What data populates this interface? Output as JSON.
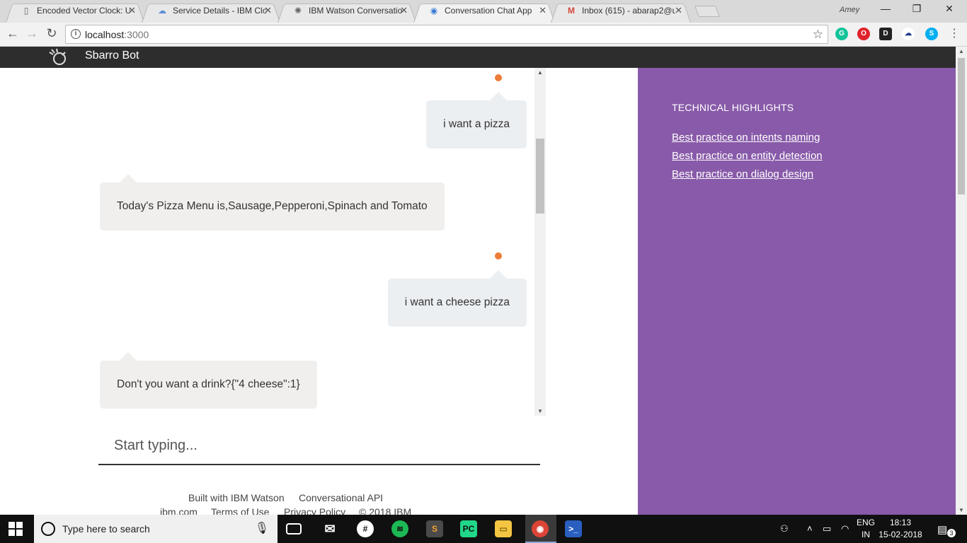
{
  "browser": {
    "tabs": [
      {
        "title": "Encoded Vector Clock: U",
        "icon": "page-icon"
      },
      {
        "title": "Service Details - IBM Clo",
        "icon": "cloud-icon"
      },
      {
        "title": "IBM Watson Conversatio",
        "icon": "watson-icon"
      },
      {
        "title": "Conversation Chat App",
        "icon": "chrome-page-icon"
      },
      {
        "title": "Inbox (615) - abarap2@u",
        "icon": "gmail-icon"
      }
    ],
    "profile_name": "Amey",
    "url_host": "localhost",
    "url_port": ":3000"
  },
  "app": {
    "title": "Sbarro Bot"
  },
  "chat": {
    "messages": [
      {
        "from": "user",
        "text": "i want a pizza"
      },
      {
        "from": "bot",
        "text": "Today's Pizza Menu is,Sausage,Pepperoni,Spinach and Tomato"
      },
      {
        "from": "user",
        "text": "i want a cheese pizza"
      },
      {
        "from": "bot",
        "text": "Don't you want a drink?{\"4 cheese\":1}"
      }
    ],
    "input_placeholder": "Start typing..."
  },
  "footer": {
    "built_with": "Built with IBM Watson",
    "api": "Conversational API",
    "link_ibm": "ibm.com",
    "link_terms": "Terms of Use",
    "link_privacy": "Privacy Policy",
    "copyright": "© 2018 IBM"
  },
  "sidebar": {
    "heading": "TECHNICAL HIGHLIGHTS",
    "links": [
      "Best practice on intents naming",
      "Best practice on entity detection",
      "Best practice on dialog design"
    ]
  },
  "taskbar": {
    "search_placeholder": "Type here to search",
    "lang_top": "ENG",
    "lang_bottom": "IN",
    "time": "18:13",
    "date": "15-02-2018",
    "notification_count": "3"
  },
  "colors": {
    "sidebar_bg": "#885aa9",
    "header_bg": "#2d2d2d",
    "status_dot": "#ee7b36"
  }
}
